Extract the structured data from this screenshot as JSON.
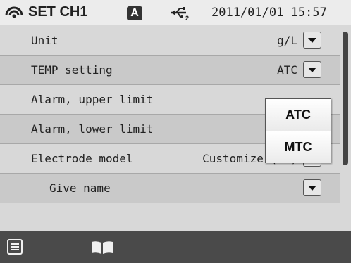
{
  "header": {
    "title": "SET CH1",
    "mode_badge": "A",
    "datetime": "2011/01/01 15:57",
    "icons": [
      "probe-icon",
      "usb-icon"
    ]
  },
  "settings": [
    {
      "label": "Unit",
      "value": "g/L"
    },
    {
      "label": "TEMP setting",
      "value": "ATC"
    },
    {
      "label": "Alarm, upper limit",
      "value": ""
    },
    {
      "label": "Alarm, lower limit",
      "value": ""
    },
    {
      "label": "Electrode model",
      "value": "Customize (X+)"
    },
    {
      "label": "Give name",
      "value": ""
    }
  ],
  "dropdown": {
    "options": [
      "ATC",
      "MTC"
    ]
  },
  "footer": {
    "icons": [
      "menu-list-icon",
      "book-icon"
    ]
  }
}
